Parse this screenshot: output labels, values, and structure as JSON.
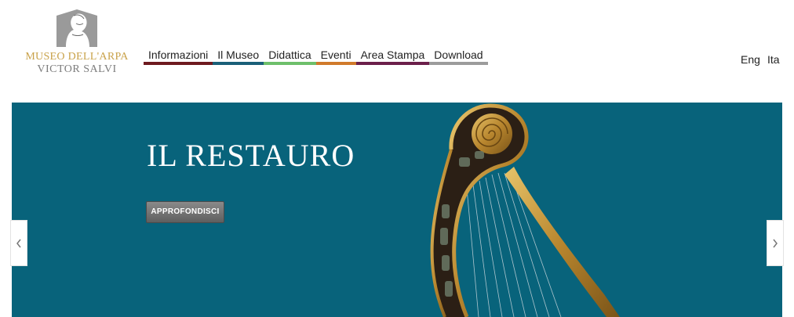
{
  "header": {
    "logo": {
      "line1": "MUSEO DELL'ARPA",
      "line2": "VICTOR SALVI"
    },
    "nav": [
      {
        "label": "Informazioni",
        "color": "#6e1a1f"
      },
      {
        "label": "Il Museo",
        "color": "#1a5f78"
      },
      {
        "label": "Didattica",
        "color": "#6dbf6a"
      },
      {
        "label": "Eventi",
        "color": "#d07a2a"
      },
      {
        "label": "Area Stampa",
        "color": "#6b1f4a"
      },
      {
        "label": "Download",
        "color": "#9c9c9c"
      }
    ],
    "languages": [
      "Eng",
      "Ita"
    ]
  },
  "hero": {
    "title": "IL RESTAURO",
    "button_label": "APPROFONDISCI",
    "background_color": "#08637b",
    "prev_icon": "chevron-left-icon",
    "next_icon": "chevron-right-icon"
  }
}
